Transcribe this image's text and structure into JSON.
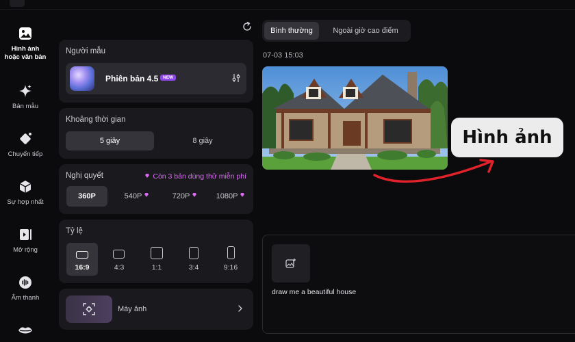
{
  "sidebar": {
    "items": [
      {
        "label_line1": "Hình ảnh",
        "label_line2": "hoặc văn bản",
        "icon": "image-icon",
        "active": true
      },
      {
        "label": "Bản mẫu",
        "icon": "sparkle-icon"
      },
      {
        "label": "Chuyển tiếp",
        "icon": "transition-icon"
      },
      {
        "label": "Sự hợp nhất",
        "icon": "cube-icon"
      },
      {
        "label": "Mở rộng",
        "icon": "extend-icon"
      },
      {
        "label": "Âm thanh",
        "icon": "audio-icon"
      },
      {
        "label": "",
        "icon": "lips-icon"
      }
    ]
  },
  "model": {
    "title": "Người mẫu",
    "name": "Phiên bản 4.5",
    "badge": "NEW"
  },
  "duration": {
    "title": "Khoảng thời gian",
    "options": [
      "5 giây",
      "8 giây"
    ],
    "selected": "5 giây"
  },
  "resolution": {
    "title": "Nghị quyết",
    "trial_text": "Còn 3 bản dùng thử miễn phí",
    "options": [
      "360P",
      "540P",
      "720P",
      "1080P"
    ],
    "selected": "360P"
  },
  "ratio": {
    "title": "Tỷ lệ",
    "options": [
      "16:9",
      "4:3",
      "1:1",
      "3:4",
      "9:16"
    ],
    "selected": "16:9"
  },
  "camera": {
    "label": "Máy ảnh"
  },
  "tabs": {
    "items": [
      "Bình thường",
      "Ngoài giờ cao điểm"
    ],
    "selected": "Bình thường"
  },
  "result": {
    "timestamp": "07-03 15:03"
  },
  "annotation": {
    "label": "Hình ảnh"
  },
  "prompt": {
    "text": "draw me a beautiful house"
  },
  "colors": {
    "accent_purple": "#8d47e8",
    "trial_pink": "#d86bf2",
    "annotation_arrow": "#e0222a"
  }
}
